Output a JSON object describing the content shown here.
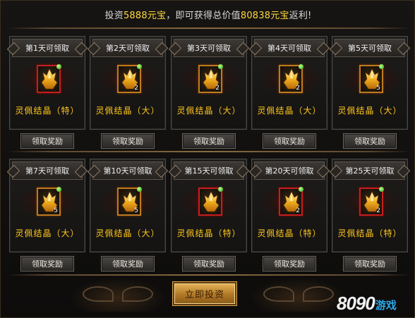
{
  "header": {
    "prefix": "投资",
    "invest_amount": "5888元宝",
    "middle": "，即可获得总价值",
    "total_value": "80838元宝",
    "suffix": "返利!"
  },
  "rewards": [
    {
      "title": "第1天可领取",
      "item": "灵佩结晶（特）",
      "count": "",
      "tier": "special",
      "button": "领取奖励"
    },
    {
      "title": "第2天可领取",
      "item": "灵佩结晶（大）",
      "count": "2",
      "tier": "large",
      "button": "领取奖励"
    },
    {
      "title": "第3天可领取",
      "item": "灵佩结晶（大）",
      "count": "2",
      "tier": "large",
      "button": "领取奖励"
    },
    {
      "title": "第4天可领取",
      "item": "灵佩结晶（大）",
      "count": "2",
      "tier": "large",
      "button": "领取奖励"
    },
    {
      "title": "第5天可领取",
      "item": "灵佩结晶（大）",
      "count": "5",
      "tier": "large",
      "button": "领取奖励"
    },
    {
      "title": "第7天可领取",
      "item": "灵佩结晶（大）",
      "count": "5",
      "tier": "large",
      "button": "领取奖励"
    },
    {
      "title": "第10天可领取",
      "item": "灵佩结晶（大）",
      "count": "5",
      "tier": "large",
      "button": "领取奖励"
    },
    {
      "title": "第15天可领取",
      "item": "灵佩结晶（特）",
      "count": "",
      "tier": "special",
      "button": "领取奖励"
    },
    {
      "title": "第20天可领取",
      "item": "灵佩结晶（特）",
      "count": "2",
      "tier": "special",
      "button": "领取奖励"
    },
    {
      "title": "第25天可领取",
      "item": "灵佩结晶（特）",
      "count": "2",
      "tier": "special",
      "button": "领取奖励"
    }
  ],
  "invest_button": "立即投资",
  "watermark": {
    "number": "8090",
    "text": "游戏"
  },
  "colors": {
    "highlight": "#ffd83a",
    "item_name": "#ffc61a",
    "special_border": "#c51e1e",
    "large_border": "#c07a1e",
    "watermark_text": "#2aa8e8"
  },
  "icons": {
    "item": "crystal-gem-icon",
    "ready": "green-dot-icon"
  }
}
